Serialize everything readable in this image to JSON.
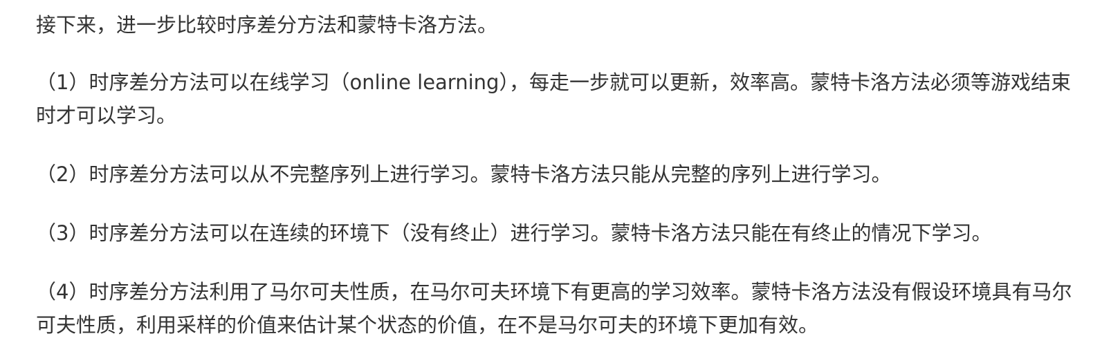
{
  "article": {
    "intro": "接下来，进一步比较时序差分方法和蒙特卡洛方法。",
    "points": [
      {
        "number": "（1）",
        "text": "时序差分方法可以在线学习（online learning），每走一步就可以更新，效率高。蒙特卡洛方法必须等游戏结束时才可以学习。"
      },
      {
        "number": "（2）",
        "text": "时序差分方法可以从不完整序列上进行学习。蒙特卡洛方法只能从完整的序列上进行学习。"
      },
      {
        "number": "（3）",
        "text": "时序差分方法可以在连续的环境下（没有终止）进行学习。蒙特卡洛方法只能在有终止的情况下学习。"
      },
      {
        "number": "（4）",
        "text": "时序差分方法利用了马尔可夫性质，在马尔可夫环境下有更高的学习效率。蒙特卡洛方法没有假设环境具有马尔可夫性质，利用采样的价值来估计某个状态的价值，在不是马尔可夫的环境下更加有效。"
      }
    ]
  }
}
